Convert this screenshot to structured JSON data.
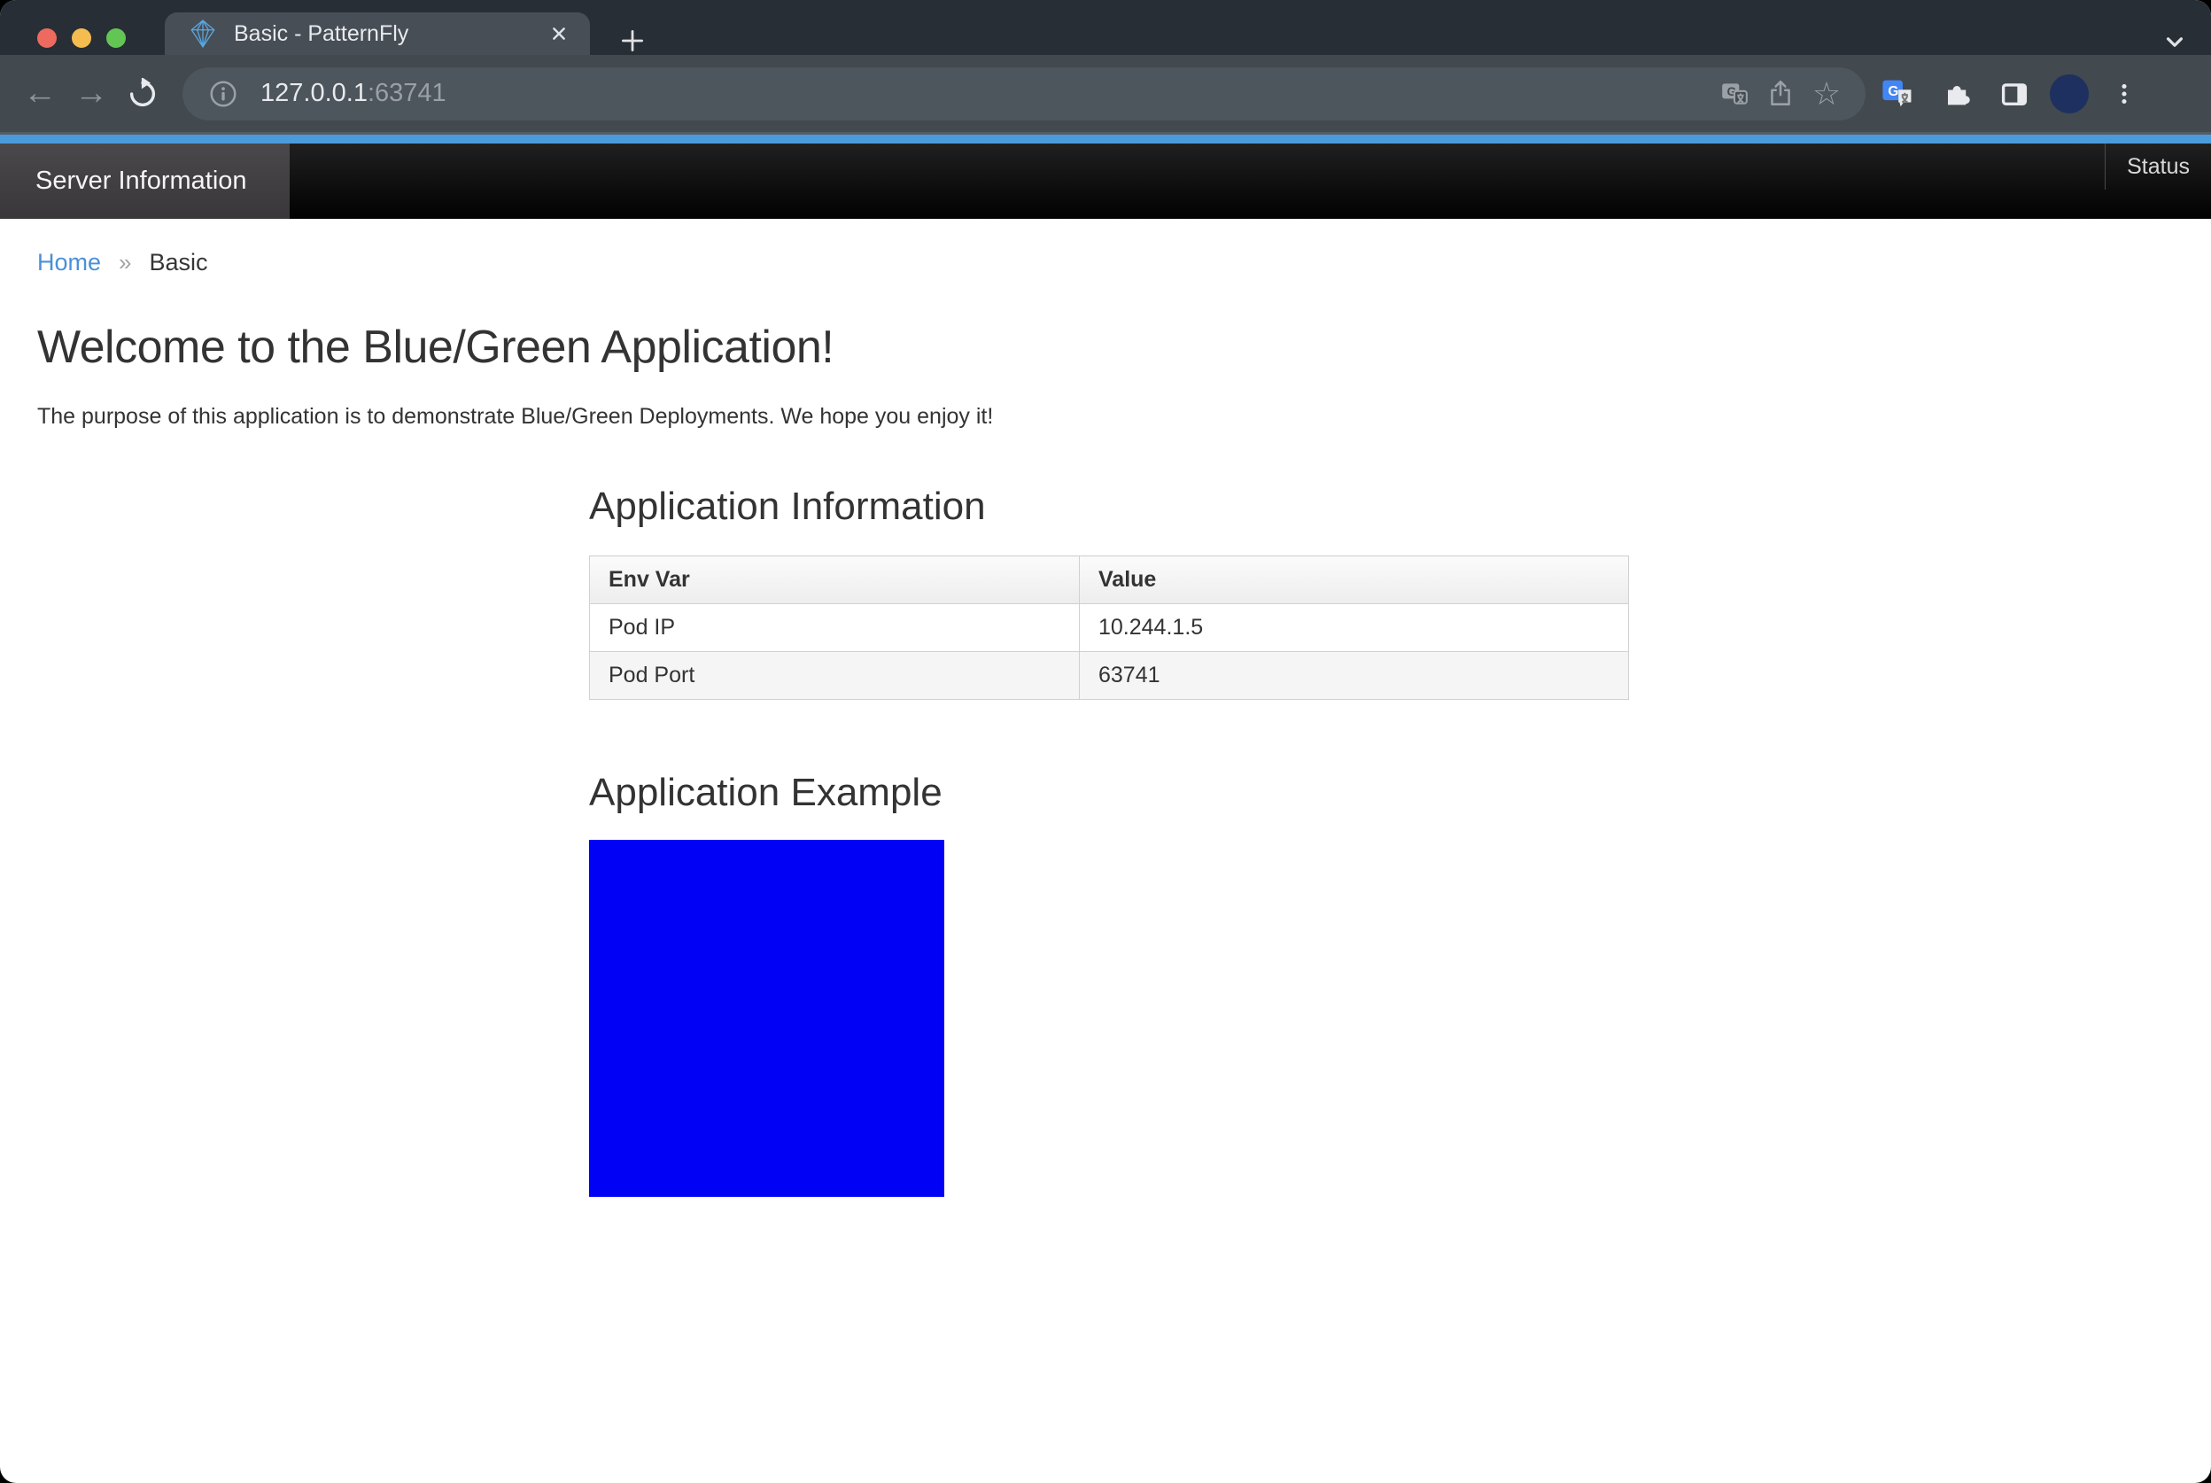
{
  "browser": {
    "tab_title": "Basic - PatternFly",
    "url_host": "127.0.0.1",
    "url_port": ":63741",
    "icons": {
      "back": "←",
      "forward": "→",
      "bookmark_star": "☆"
    }
  },
  "masthead": {
    "brand": "Server Information",
    "status": "Status"
  },
  "breadcrumb": {
    "home": "Home",
    "separator": "»",
    "current": "Basic"
  },
  "page": {
    "heading": "Welcome to the Blue/Green Application!",
    "intro": "The purpose of this application is to demonstrate Blue/Green Deployments. We hope you enjoy it!",
    "info_section": {
      "title": "Application Information",
      "table": {
        "headers": [
          "Env Var",
          "Value"
        ],
        "rows": [
          [
            "Pod IP",
            "10.244.1.5"
          ],
          [
            "Pod Port",
            "63741"
          ]
        ]
      }
    },
    "example_section": {
      "title": "Application Example",
      "square_color": "#0101f5"
    }
  },
  "colors": {
    "accent_bar": "#4b9bdb",
    "link": "#4a90d9"
  }
}
